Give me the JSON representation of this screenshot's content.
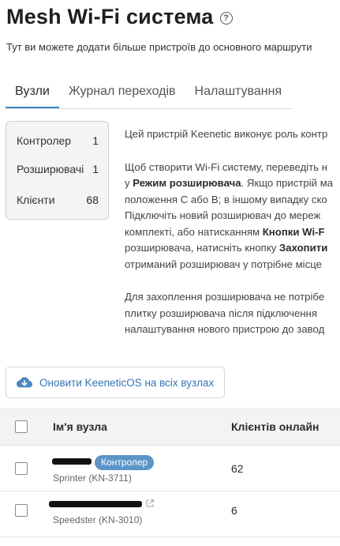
{
  "header": {
    "title": "Mesh Wi-Fi система",
    "help_glyph": "?",
    "subtitle": "Тут ви можете додати більше пристроїв до основного маршрути"
  },
  "tabs": [
    {
      "label": "Вузли",
      "active": true
    },
    {
      "label": "Журнал переходів",
      "active": false
    },
    {
      "label": "Налаштування",
      "active": false
    }
  ],
  "stats": [
    {
      "label": "Контролер",
      "value": "1"
    },
    {
      "label": "Розширювачі",
      "value": "1"
    },
    {
      "label": "Клієнти",
      "value": "68"
    }
  ],
  "description": {
    "p1_line1": "Цей пристрій Keenetic виконує роль контр",
    "p2_line1": "Щоб створити Wi-Fi систему, переведіть н",
    "p2_line2_pre": "у ",
    "p2_line2_bold": "Режим розширювача",
    "p2_line2_post": ". Якщо пристрій ма",
    "p2_line3": "положення C або B; в іншому випадку ско",
    "p2_line4": "Підключіть новий розширювач до мереж",
    "p2_line5_pre": "комплекті, або натисканням ",
    "p2_line5_bold": "Кнопки Wi-F",
    "p2_line6_pre": "розширювача, натисніть кнопку ",
    "p2_line6_bold": "Захопити",
    "p2_line7": "отриманий розширювач у потрібне місце",
    "p3_line1": "Для захоплення розширювача не потрібе",
    "p3_line2": "плитку розширювача після підключення",
    "p3_line3": "налаштування нового пристрою до завод"
  },
  "update_button": {
    "label": "Оновити KeeneticOS на всіх вузлах",
    "icon": "cloud-download-icon"
  },
  "table": {
    "columns": [
      "Ім'я вузла",
      "Клієнтів онлайн"
    ],
    "rows": [
      {
        "badge": "Контролер",
        "model": "Sprinter (KN-3711)",
        "clients": "62"
      },
      {
        "model": "Speedster (KN-3010)",
        "clients": "6"
      }
    ]
  },
  "colors": {
    "accent": "#3b86c9",
    "badge": "#5b95c9",
    "link": "#3575b5"
  }
}
